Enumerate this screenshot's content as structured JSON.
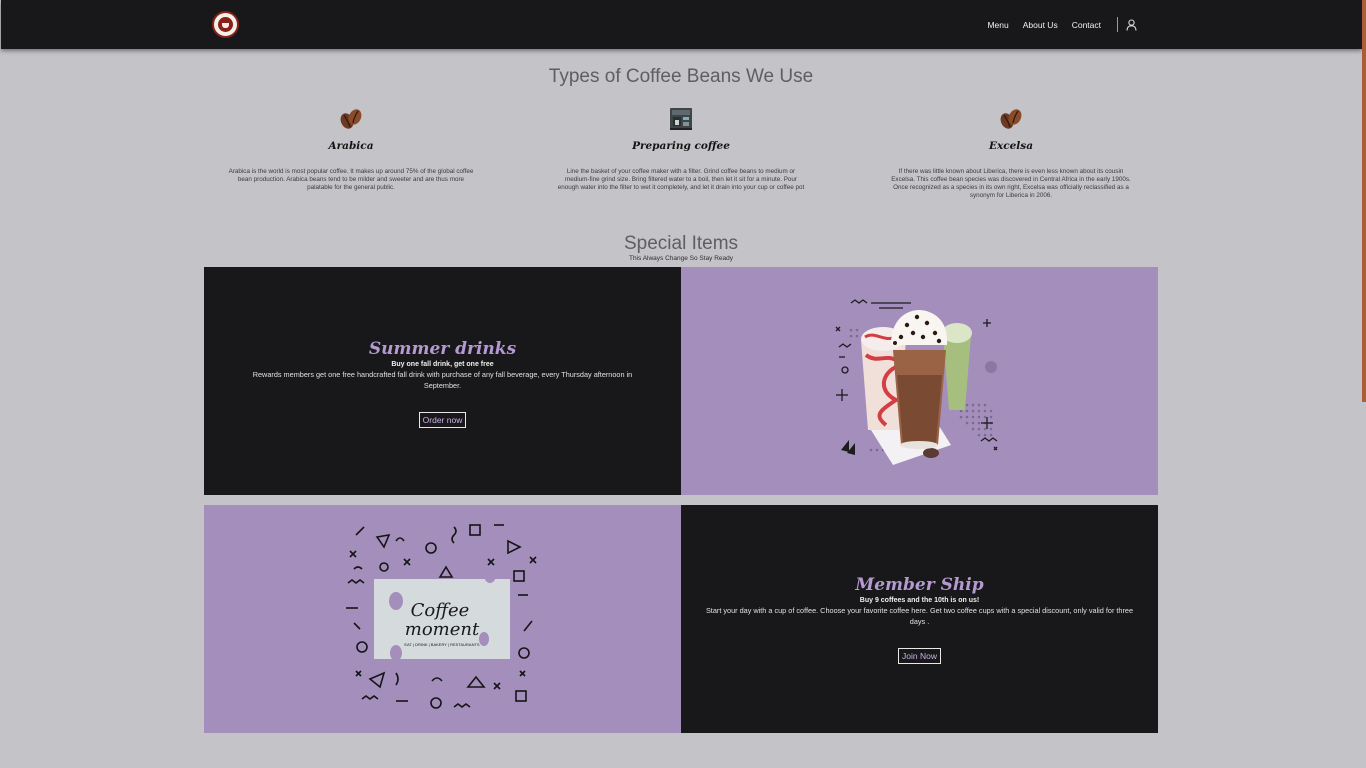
{
  "nav": {
    "items": [
      "Menu",
      "About Us",
      "Contact"
    ]
  },
  "types": {
    "title": "Types of Coffee Beans We Use",
    "columns": [
      {
        "icon": "coffee-beans-icon",
        "name": "Arabica",
        "text": "Arabica is the world is most popular coffee. It makes up around 75% of the global coffee bean production. Arabica beans tend to be milder and sweeter and are thus more palatable for the general public."
      },
      {
        "icon": "coffee-maker-icon",
        "name": "Preparing coffee",
        "text": "Line the basket of your coffee maker with a filter. Grind coffee beans to medium or medium-fine grind size. Bring filtered water to a boil, then let it sit for a minute. Pour enough water into the filter to wet it completely, and let it drain into your cup or coffee pot"
      },
      {
        "icon": "coffee-beans-icon",
        "name": "Excelsa",
        "text": "If there was little known about Liberica, there is even less known about its cousin Excelsa. This coffee bean species was discovered in Central Africa in the early 1900s. Once recognized as a species in its own right, Excelsa was officially reclassified as a synonym for Liberica in 2006."
      }
    ]
  },
  "special": {
    "title": "Special Items",
    "subtitle": "This Always Change So Stay Ready",
    "summer": {
      "title": "Summer drinks",
      "headline": "Buy one fall drink, get one free",
      "text": "Rewards members get one free handcrafted fall drink with purchase of any fall beverage, every Thursday afternoon in September.",
      "button": "Order now"
    },
    "membership": {
      "title": "Member Ship",
      "headline": "Buy 9 coffees and the 10th is on us!",
      "text": "Start your day with a cup of coffee. Choose your favorite coffee here. Get two coffee cups with a special discount, only valid for three days .",
      "button": "Join Now"
    },
    "poster": {
      "title_line1": "Coffee",
      "title_line2": "moment",
      "tagline": "EAT | DRINK | BAKERY | RESTAURANTS"
    }
  },
  "colors": {
    "nav_bg": "#18181b",
    "page_bg": "#c4c3c7",
    "accent": "#b49ad1",
    "lilac": "#a48ebb"
  }
}
